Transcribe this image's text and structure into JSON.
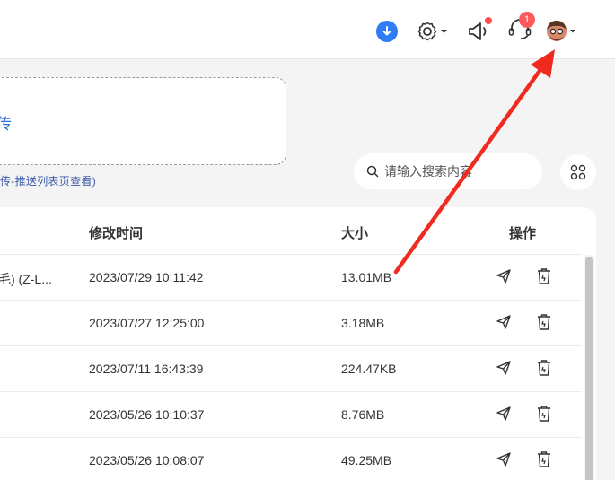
{
  "header": {
    "download_icon": "download-icon",
    "settings_icon": "gear-icon",
    "notice_icon": "speaker-icon",
    "support_icon": "headset-icon",
    "support_badge": "1",
    "avatar_icon": "avatar"
  },
  "upload": {
    "label": "传",
    "hint": "传-推送列表页查看)"
  },
  "search": {
    "placeholder": "请输入搜索内容"
  },
  "table": {
    "columns": {
      "modified": "修改时间",
      "size": "大小",
      "actions": "操作"
    },
    "rows": [
      {
        "name": "毛) (Z-L...",
        "modified": "2023/07/29 10:11:42",
        "size": "13.01MB"
      },
      {
        "name": "",
        "modified": "2023/07/27 12:25:00",
        "size": "3.18MB"
      },
      {
        "name": "",
        "modified": "2023/07/11 16:43:39",
        "size": "224.47KB"
      },
      {
        "name": "",
        "modified": "2023/05/26 10:10:37",
        "size": "8.76MB"
      },
      {
        "name": "",
        "modified": "2023/05/26 10:08:07",
        "size": "49.25MB"
      }
    ]
  },
  "colors": {
    "accent": "#2f7cf6",
    "badge": "#ff5a5a",
    "annotation_arrow": "#f02a1e"
  }
}
